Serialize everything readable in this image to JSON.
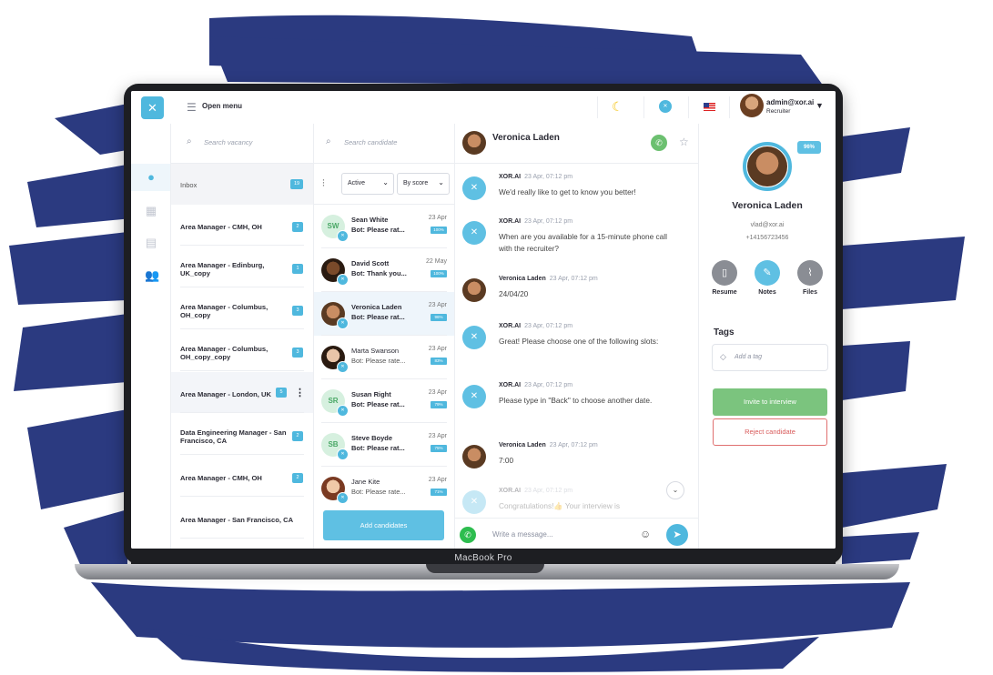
{
  "topbar": {
    "menu_label": "Open menu",
    "user_email": "admin@xor.ai",
    "user_role": "Recruiter"
  },
  "vacancies": {
    "search_placeholder": "Search vacancy",
    "inbox_label": "Inbox",
    "inbox_count": "19",
    "items": [
      {
        "label": "Area Manager - CMH, OH",
        "count": "2"
      },
      {
        "label": "Area Manager - Edinburg, UK_copy",
        "count": "1"
      },
      {
        "label": "Area Manager - Columbus, OH_copy",
        "count": "3"
      },
      {
        "label": "Area Manager - Columbus, OH_copy_copy",
        "count": "3"
      },
      {
        "label": "Area Manager - London, UK",
        "count": "5"
      },
      {
        "label": "Data Engineering Manager - San Francisco, CA",
        "count": "2"
      },
      {
        "label": "Area Manager - CMH, OH",
        "count": "2"
      },
      {
        "label": "Area Manager - San Francisco, CA",
        "count": ""
      }
    ]
  },
  "candidates": {
    "search_placeholder": "Search candidate",
    "status_filter": "Active",
    "sort_filter": "By score",
    "add_button": "Add candidates",
    "items": [
      {
        "initials": "SW",
        "name": "Sean White",
        "message": "Bot: Please rat...",
        "date": "23 Apr",
        "score": "100%"
      },
      {
        "initials": "",
        "name": "David Scott",
        "message": "Bot: Thank you...",
        "date": "22 May",
        "score": "100%"
      },
      {
        "initials": "",
        "name": "Veronica Laden",
        "message": "Bot: Please rat...",
        "date": "23 Apr",
        "score": "96%"
      },
      {
        "initials": "",
        "name": "Marta Swanson",
        "message": "Bot: Please rate...",
        "date": "23 Apr",
        "score": "83%"
      },
      {
        "initials": "SR",
        "name": "Susan Right",
        "message": "Bot: Please rat...",
        "date": "23 Apr",
        "score": "79%"
      },
      {
        "initials": "SB",
        "name": "Steve Boyde",
        "message": "Bot: Please rat...",
        "date": "23 Apr",
        "score": "75%"
      },
      {
        "initials": "",
        "name": "Jane Kite",
        "message": "Bot: Please rate...",
        "date": "23 Apr",
        "score": "71%"
      }
    ]
  },
  "chat": {
    "contact_name": "Veronica Laden",
    "composer_placeholder": "Write a message...",
    "messages": [
      {
        "from": "XOR.AI",
        "time": "23 Apr, 07:12 pm",
        "text": "We'd really like to get to know you better!"
      },
      {
        "from": "XOR.AI",
        "time": "23 Apr, 07:12 pm",
        "text": "When are you available for a 15-minute phone call with the recruiter?"
      },
      {
        "from": "Veronica Laden",
        "time": "23 Apr, 07:12 pm",
        "text": "24/04/20"
      },
      {
        "from": "XOR.AI",
        "time": "23 Apr, 07:12 pm",
        "text": "Great! Please choose one of the following slots:"
      },
      {
        "from": "XOR.AI",
        "time": "23 Apr, 07:12 pm",
        "text": "Please type in \"Back\" to choose another date."
      },
      {
        "from": "Veronica Laden",
        "time": "23 Apr, 07:12 pm",
        "text": "7:00"
      },
      {
        "from": "XOR.AI",
        "time": "23 Apr, 07:12 pm",
        "text": "Congratulations!👍 Your interview is"
      }
    ]
  },
  "profile": {
    "score": "96%",
    "name": "Veronica Laden",
    "email": "vlad@xor.ai",
    "phone": "+14156723456",
    "actions": {
      "resume": "Resume",
      "notes": "Notes",
      "files": "Files"
    },
    "tags_title": "Tags",
    "tag_placeholder": "Add a tag",
    "invite_button": "Invite to interview",
    "reject_button": "Reject candidate"
  },
  "device": {
    "label": "MacBook Pro"
  },
  "colors": {
    "accent": "#4fb8de",
    "brand_splash": "#2b3a80",
    "invite": "#7bc47e",
    "reject": "#d85a5a"
  }
}
